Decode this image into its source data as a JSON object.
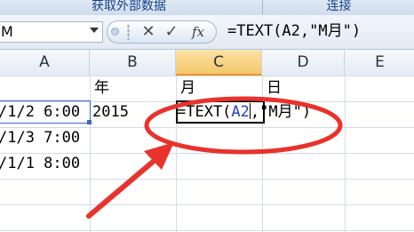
{
  "ribbon": {
    "group1_label": "获取外部数据",
    "group2_label": "连接"
  },
  "formula_bar": {
    "name_box_value": "M",
    "cancel_glyph": "✕",
    "enter_glyph": "✓",
    "function_glyph": "fx",
    "formula": "=TEXT(A2,\"M月\")"
  },
  "columns": [
    "A",
    "B",
    "C",
    "D",
    "E"
  ],
  "active_column": "C",
  "cells": {
    "B1": "年",
    "C1": "月",
    "D1": "日",
    "A2": "/1/2 6:00",
    "B2": "2015",
    "A3": "/1/3 7:00",
    "A4": "/1/1 8:00"
  },
  "editing_cell": {
    "prefix": "=TEXT(",
    "ref": "A2",
    "suffix": ",\"M月\")"
  },
  "colors": {
    "annotation": "#e8322b",
    "cell_reference": "#1e3fc4",
    "selection_border": "#3a66c8",
    "active_header": "#f7c66a"
  }
}
